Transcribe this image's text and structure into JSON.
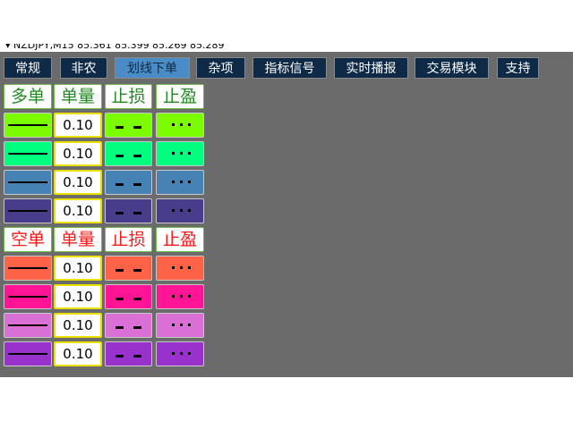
{
  "chart": {
    "ticker_text": "▾  NZDJPY,M15  85.361 85.399 85.269 85.289"
  },
  "tabs": [
    {
      "label": "常规",
      "active": false
    },
    {
      "label": "非农",
      "active": false
    },
    {
      "label": "划线下单",
      "active": true
    },
    {
      "label": "杂项",
      "active": false
    },
    {
      "label": "指标信号",
      "active": false
    },
    {
      "label": "实时播报",
      "active": false
    },
    {
      "label": "交易模块",
      "active": false
    },
    {
      "label": "支持",
      "active": false
    }
  ],
  "buy_panel": {
    "headers": [
      "多单",
      "单量",
      "止损",
      "止盈"
    ],
    "rows": [
      {
        "color": "#7cfc00",
        "lot": "0.10"
      },
      {
        "color": "#00ff7f",
        "lot": "0.10"
      },
      {
        "color": "#4682b4",
        "lot": "0.10"
      },
      {
        "color": "#483d8b",
        "lot": "0.10"
      }
    ]
  },
  "sell_panel": {
    "headers": [
      "空单",
      "单量",
      "止损",
      "止盈"
    ],
    "rows": [
      {
        "color": "#ff6347",
        "lot": "0.10"
      },
      {
        "color": "#ff1493",
        "lot": "0.10"
      },
      {
        "color": "#da70d6",
        "lot": "0.10"
      },
      {
        "color": "#9932cc",
        "lot": "0.10"
      }
    ]
  }
}
